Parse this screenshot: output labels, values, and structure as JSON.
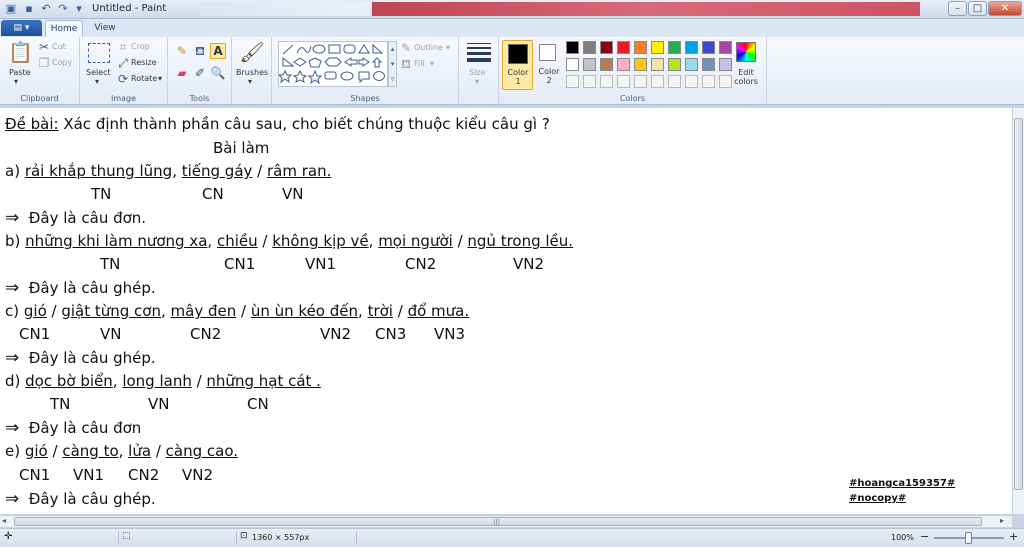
{
  "window": {
    "title": "Untitled - Paint"
  },
  "tabs": {
    "file": "▾",
    "home": "Home",
    "view": "View"
  },
  "ribbon": {
    "clipboard": {
      "label": "Clipboard",
      "paste": "Paste",
      "cut": "Cut",
      "copy": "Copy"
    },
    "image": {
      "label": "Image",
      "select": "Select",
      "crop": "Crop",
      "resize": "Resize",
      "rotate": "Rotate"
    },
    "tools": {
      "label": "Tools"
    },
    "brushes": {
      "label": "Brushes"
    },
    "shapes": {
      "label": "Shapes",
      "outline": "Outline",
      "fill": "Fill"
    },
    "size": {
      "label": "Size"
    },
    "colors": {
      "label": "Colors",
      "color1": "Color\n1",
      "color2": "Color\n2",
      "edit": "Edit\ncolors",
      "color1_value": "#000000",
      "color2_value": "#ffffff",
      "palette_row1": [
        "#000000",
        "#7f7f7f",
        "#880015",
        "#ed1c24",
        "#ff7f27",
        "#fff200",
        "#22b14c",
        "#00a2e8",
        "#3f48cc",
        "#a349a4"
      ],
      "palette_row2": [
        "#ffffff",
        "#c3c3c3",
        "#b97a57",
        "#ffaec9",
        "#ffc90e",
        "#efe4b0",
        "#b5e61d",
        "#99d9ea",
        "#7092be",
        "#c8bfe7"
      ]
    }
  },
  "canvas": {
    "heading_label": "Đề bài:",
    "heading_text": " Xác định thành phần câu sau, cho biết chúng thuộc kiểu câu gì ?",
    "bai_lam": "Bài làm",
    "a": {
      "prefix": "a) ",
      "p1": "rải khắp thung lũng",
      "s1": ", ",
      "p2": "tiếng gáy",
      "s2": " / ",
      "p3": "râm ran.",
      "tags": [
        "TN",
        "CN",
        "VN"
      ],
      "conclusion": "Đây là câu đơn."
    },
    "b": {
      "prefix": "b) ",
      "p1": "những khi làm nương xa",
      "s1": ", ",
      "p2": "chiều",
      "s2": " / ",
      "p3": "không kịp về",
      "s3": ", ",
      "p4": "mọi người",
      "s4": " / ",
      "p5": "ngủ trong lều.",
      "tags": [
        "TN",
        "CN1",
        "VN1",
        "CN2",
        "VN2"
      ],
      "conclusion": "Đây là câu ghép."
    },
    "c": {
      "prefix": "c) ",
      "p1": "gió",
      "s1": " / ",
      "p2": "giật từng cơn",
      "s2": ", ",
      "p3": "mây đen",
      "s3": " / ",
      "p4": "ùn ùn kéo đến",
      "s4": ", ",
      "p5": "trời",
      "s5": " / ",
      "p6": "đổ mưa.",
      "tags": [
        "CN1",
        "VN",
        "CN2",
        "VN2",
        "CN3",
        "VN3"
      ],
      "conclusion": "Đây là câu ghép."
    },
    "d": {
      "prefix": "d) ",
      "p1": "dọc bờ biển",
      "s1": ", ",
      "p2": "long lanh",
      "s2": " / ",
      "p3": "những hạt cát .",
      "tags": [
        "TN",
        "VN",
        "CN"
      ],
      "conclusion": "Đây là câu đơn"
    },
    "e": {
      "prefix": "e) ",
      "p1": "gió",
      "s1": " / ",
      "p2": "càng to",
      "s2": ",  ",
      "p3": "lửa",
      "s3": " / ",
      "p4": "càng cao.",
      "tags": [
        "CN1",
        "VN1",
        "CN2",
        "VN2"
      ],
      "conclusion": "Đây là câu ghép."
    },
    "arrow": "⇒",
    "hashtag1": "#hoangca159357#",
    "hashtag2": "#nocopy#"
  },
  "status": {
    "dimensions": "1360 × 557px",
    "zoom": "100%",
    "zoom_out": "−",
    "zoom_in": "+"
  }
}
